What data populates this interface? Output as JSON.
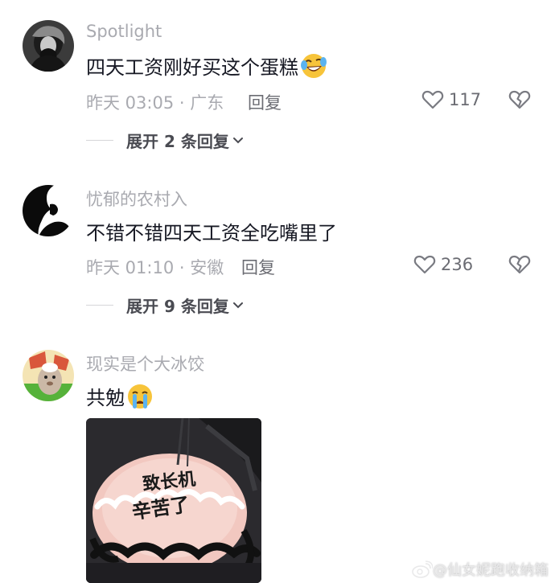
{
  "comments": [
    {
      "username": "Spotlight",
      "content": "四天工资刚好买这个蛋糕",
      "emoji": "laughing-tears-emoji",
      "time_location": "昨天 03:05 · 广东",
      "reply_label": "回复",
      "like_count": "117",
      "expand_label": "展开 2 条回复"
    },
    {
      "username": "忧郁的农村入",
      "content": "不错不错四天工资全吃嘴里了",
      "time_location": "昨天 01:10 · 安徽",
      "reply_label": "回复",
      "like_count": "236",
      "expand_label": "展开 9 条回复"
    },
    {
      "username": "现实是个大冰饺",
      "content": "共勉",
      "emoji": "crying-emoji",
      "cake_text_line1": "致长机",
      "cake_text_line2": "辛苦了"
    }
  ],
  "watermark": "@仙女妮跑收纳箱",
  "colors": {
    "text_primary": "#161823",
    "text_secondary": "#a9aab0",
    "text_action": "#6b6c73",
    "background": "#ffffff"
  }
}
